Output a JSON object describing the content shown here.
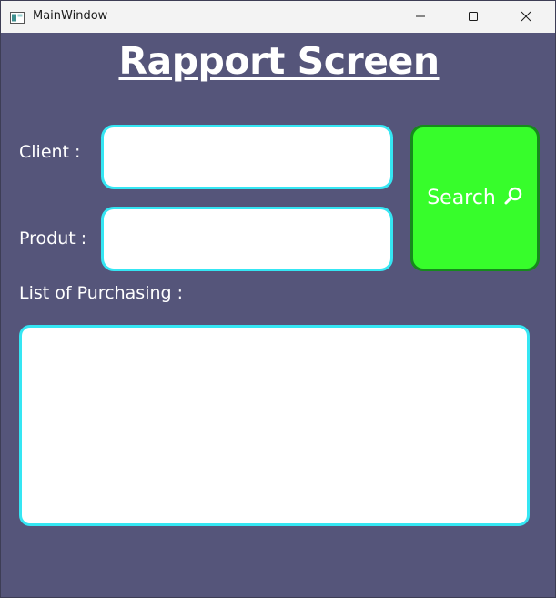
{
  "window": {
    "title": "MainWindow",
    "background_color": "#55557a",
    "icons": {
      "app": "window-app-icon",
      "minimize": "minimize-icon",
      "maximize": "maximize-icon",
      "close": "close-icon"
    }
  },
  "page": {
    "title": "Rapport Screen"
  },
  "form": {
    "client_label": "Client :",
    "client_value": "",
    "produt_label": "Produt :",
    "produt_value": "",
    "list_label": "List of  Purchasing :",
    "input_border_color": "#35e6f3"
  },
  "search_button": {
    "label": "Search",
    "icon": "search-icon",
    "background_color": "#37fd2b",
    "border_color": "#168a1c"
  },
  "purchase_list": {
    "items": []
  }
}
